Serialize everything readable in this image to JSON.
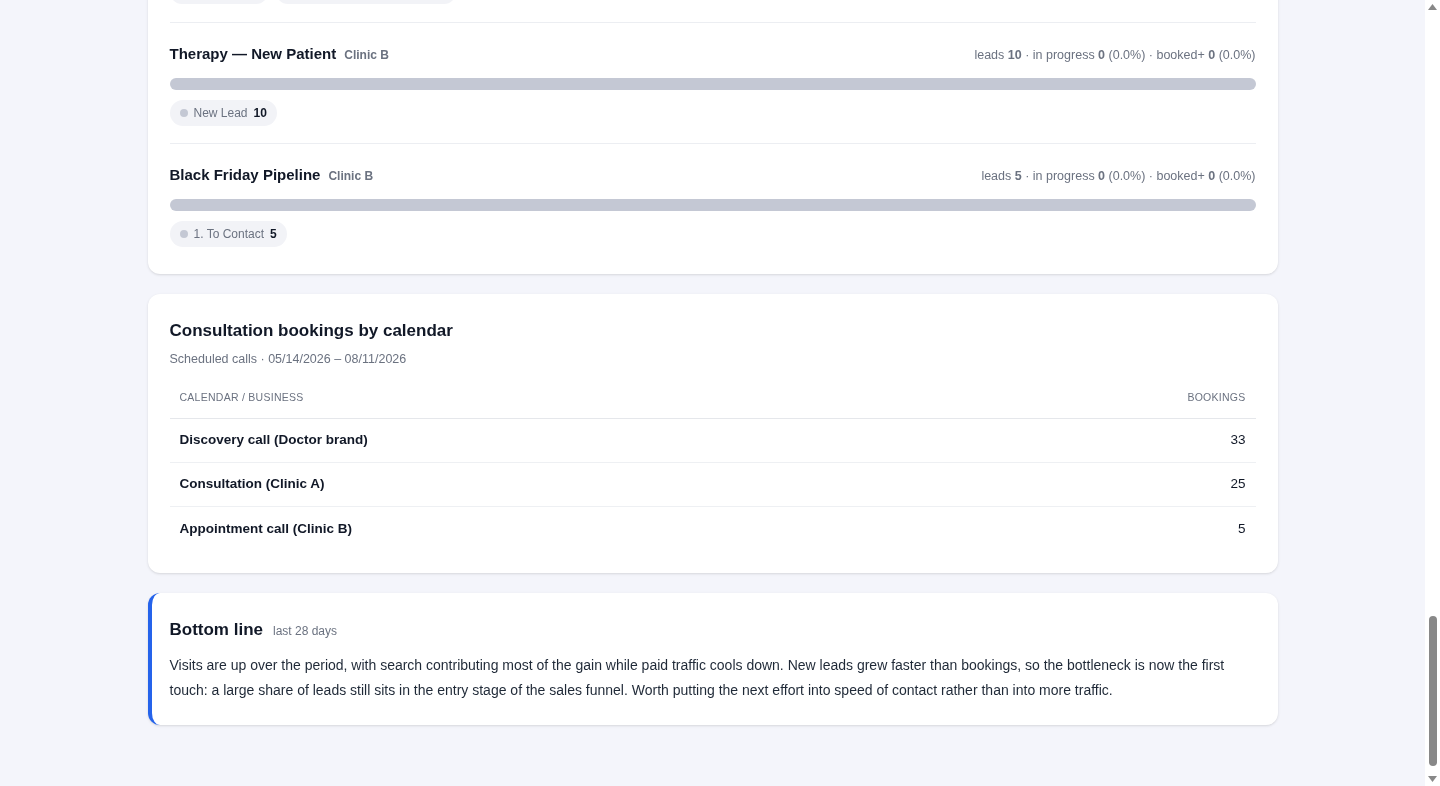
{
  "pipelines": [
    {
      "name": "Therapy — New Patient",
      "business": "Clinic B",
      "stats": "leads **10** · in progress **0** (0.0%) · booked+ **0** (0.0%)",
      "level": 0,
      "stages": [
        {
          "label": "New Lead",
          "count": "10",
          "color": "#c4c8d4"
        }
      ]
    },
    {
      "name": "Black Friday Pipeline",
      "business": "Clinic B",
      "stats": "leads **5** · in progress **0** (0.0%) · booked+ **0** (0.0%)",
      "level": 0,
      "stages": [
        {
          "label": "1. To Contact",
          "count": "5",
          "color": "#c4c8d4"
        }
      ]
    }
  ],
  "bookings": {
    "title": "Consultation bookings by calendar",
    "subtitle": "Scheduled calls · 05/14/2026 – 08/11/2026",
    "columns": [
      "CALENDAR / BUSINESS",
      "BOOKINGS"
    ],
    "rows": [
      {
        "calendar": "Discovery call (Doctor brand)",
        "bookings": "33"
      },
      {
        "calendar": "Consultation (Clinic A)",
        "bookings": "25"
      },
      {
        "calendar": "Appointment call (Clinic B)",
        "bookings": "5"
      }
    ]
  },
  "bottom_line": {
    "title": "Bottom line",
    "period": "last 28 days",
    "text": "Visits are up over the period, with search contributing most of the gain while paid traffic cools down. New leads grew faster than bookings, so the bottleneck is now the first touch: a large share of leads still sits in the entry stage of the sales funnel. Worth putting the next effort into speed of contact rather than into more traffic."
  }
}
